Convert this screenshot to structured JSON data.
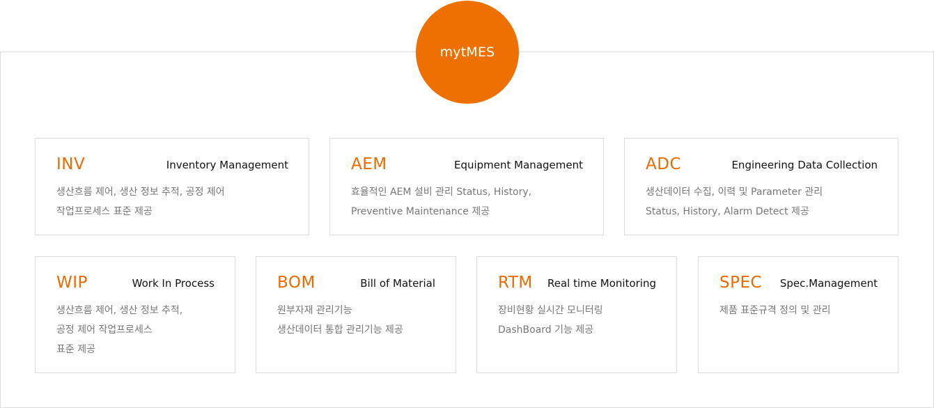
{
  "center": {
    "label": "mytMES"
  },
  "colors": {
    "accent": "#ec6a00",
    "badge": "#ee7000",
    "border": "#dcdcdc",
    "text": "#111111",
    "muted": "#777777"
  },
  "modules": [
    {
      "code": "INV",
      "title": "Inventory Management",
      "lines": [
        "생산흐름 제어, 생산 정보 추적, 공정 제어",
        "작업프로세스 표준 제공"
      ]
    },
    {
      "code": "AEM",
      "title": "Equipment Management",
      "lines": [
        "효율적인 AEM 설비 관리 Status, History,",
        "Preventive Maintenance 제공"
      ]
    },
    {
      "code": "ADC",
      "title": "Engineering Data Collection",
      "lines": [
        "생산데이터 수집, 이력 및 Parameter 관리",
        "Status, History, Alarm Detect 제공"
      ]
    },
    {
      "code": "WIP",
      "title": "Work In Process",
      "lines": [
        "생산흐름 제어, 생산 정보 추적,",
        "공정 제어 작업프로세스",
        "표준 제공"
      ]
    },
    {
      "code": "BOM",
      "title": "Bill of Material",
      "lines": [
        "원부자재 관리기능",
        "생산데이터 통합 관리기능 제공"
      ]
    },
    {
      "code": "RTM",
      "title": "Real time Monitoring",
      "lines": [
        "장비현황 실시간 모니터링",
        "DashBoard 기능 제공"
      ]
    },
    {
      "code": "SPEC",
      "title": "Spec.Management",
      "lines": [
        "제품 표준규격 정의 및 관리"
      ]
    }
  ]
}
